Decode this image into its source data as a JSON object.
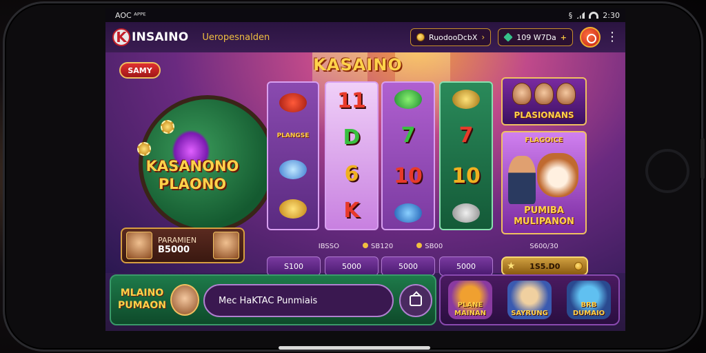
{
  "status_bar": {
    "left": "AOC ᴬᴾᴾᴱ",
    "time": "2:30",
    "right_glyph": "§"
  },
  "header": {
    "logo_letter": "K",
    "logo_text": "INSAINO",
    "nav_link": "Ueropesnalden",
    "balance_pill": "RuodooDcbX",
    "gems_pill": "109 W7Da",
    "accent_color": "#f0c040"
  },
  "stage": {
    "badge": "SAMY",
    "table_title_line1": "KASANONO",
    "table_title_line2": "PLAONO",
    "promo": {
      "label": "PARAMIEN",
      "amount": "B5000"
    }
  },
  "slot": {
    "title": "KASAINO",
    "reel1": [
      "",
      "PLANGSE",
      "",
      ""
    ],
    "reel2": [
      "11",
      "D",
      "6",
      "K"
    ],
    "reel3": [
      "",
      "7",
      "10",
      ""
    ],
    "reel4": [
      "",
      "7",
      "10",
      ""
    ]
  },
  "side_cards": {
    "top_title": "PLASIONANS",
    "big_head": "FLAGOICE",
    "big_title_line1": "PUMIBA",
    "big_title_line2": "MULIPANON",
    "amount_label": "S600/30"
  },
  "bet_row": {
    "labels": [
      "IBSSO",
      "SB120",
      "SB00"
    ],
    "buttons": [
      "S100",
      "5000",
      "5000",
      "5000"
    ],
    "total": "1S5.D0"
  },
  "bottom": {
    "logo_line1": "MLAINO",
    "logo_line2": "PUMAON",
    "chat_text": "Mec HaKTAC Punmiais"
  },
  "games": [
    {
      "label": "PLANE MAINAN"
    },
    {
      "label": "SAYRUNG"
    },
    {
      "label": "BRB DUMAIO"
    }
  ]
}
